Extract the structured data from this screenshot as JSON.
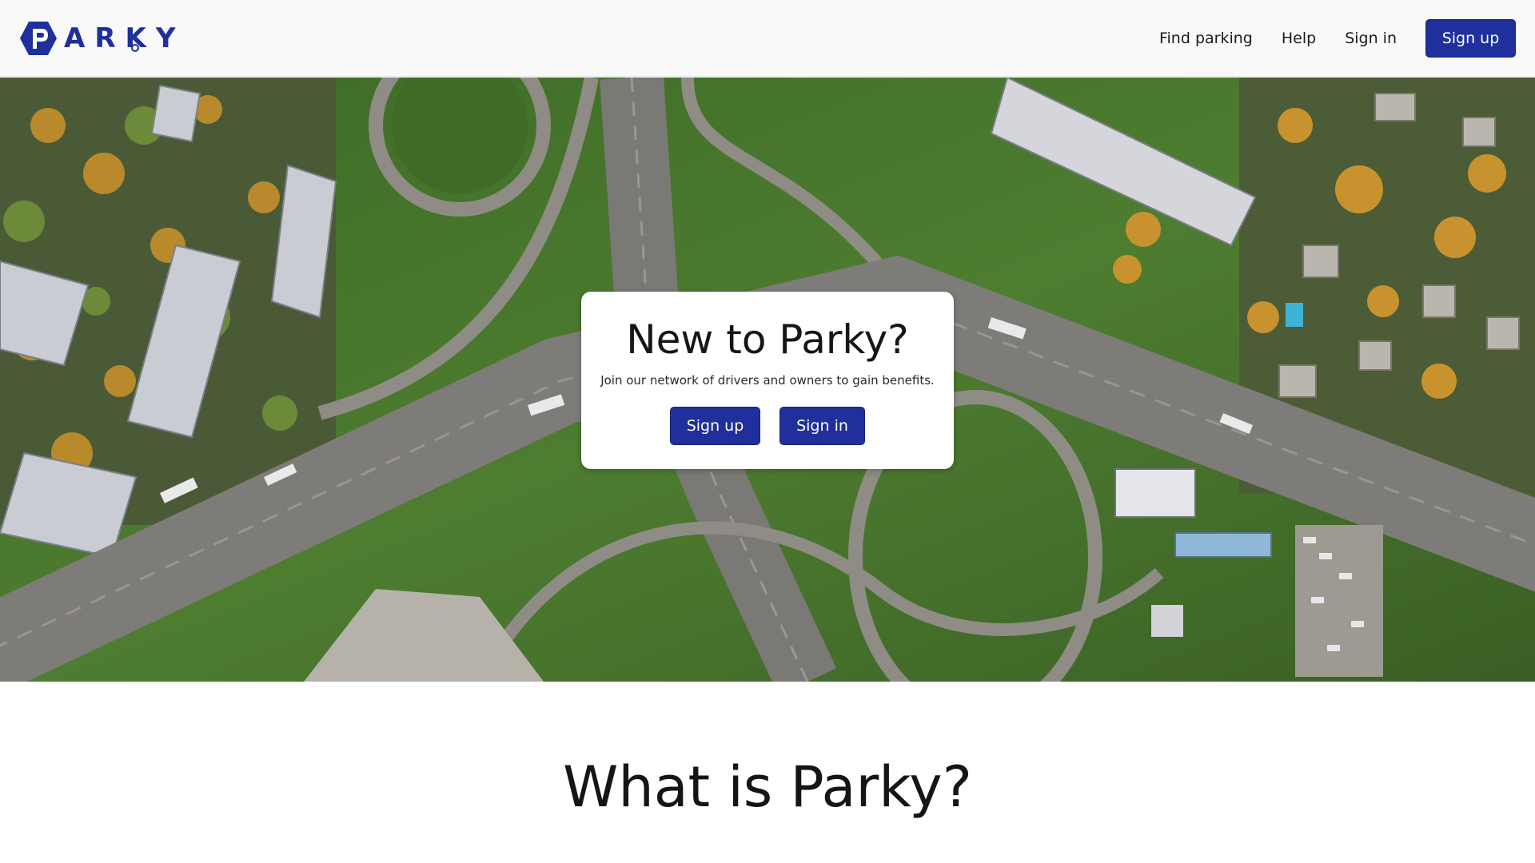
{
  "brand": {
    "name": "PARKY",
    "color": "#1f2f9b"
  },
  "nav": {
    "find_parking": "Find parking",
    "help": "Help",
    "sign_in": "Sign in",
    "sign_up": "Sign up"
  },
  "hero": {
    "image": "aerial-highway-interchange",
    "title": "New to Parky?",
    "subtitle": "Join our network of drivers and owners to gain benefits.",
    "sign_up": "Sign up",
    "sign_in": "Sign in"
  },
  "section": {
    "title": "What is Parky?"
  }
}
